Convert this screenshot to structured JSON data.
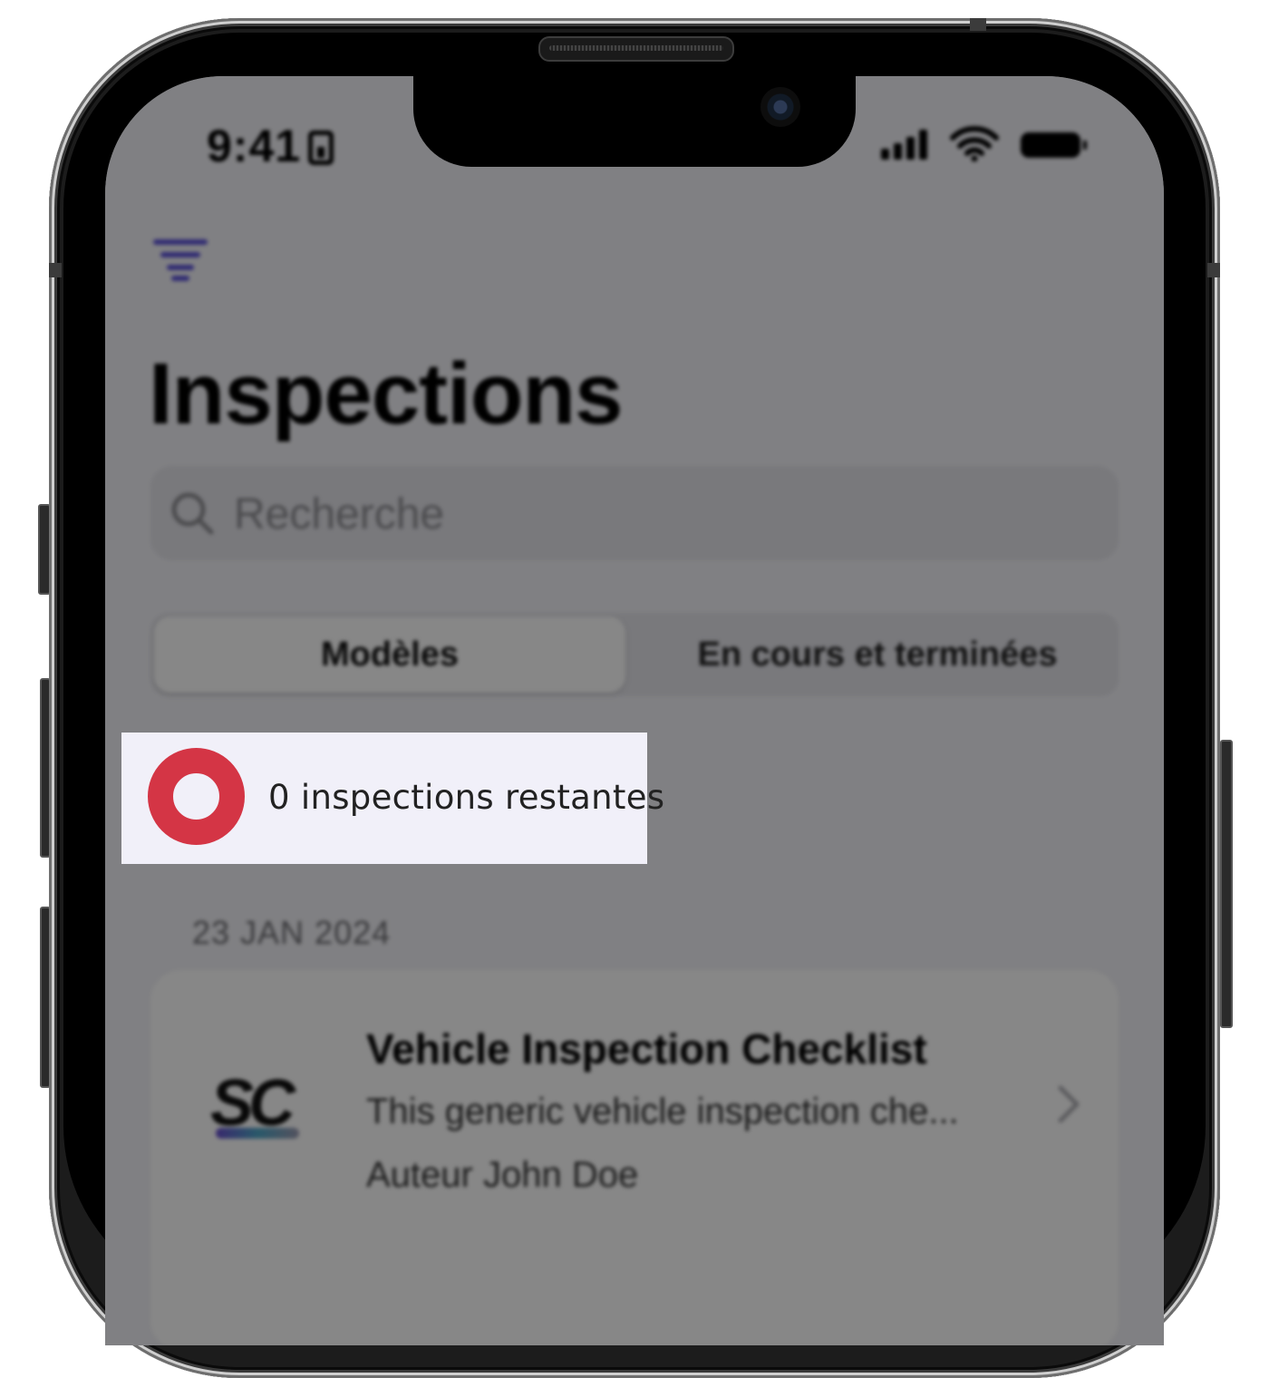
{
  "status_bar": {
    "time": "9:41"
  },
  "header": {
    "title": "Inspections"
  },
  "search": {
    "placeholder": "Recherche"
  },
  "tabs": [
    {
      "label": "Modèles",
      "active": true
    },
    {
      "label": "En cours et terminées",
      "active": false
    }
  ],
  "toast": {
    "text": "0 inspections restantes",
    "ring_color": "#d43545"
  },
  "list": {
    "section_date": "23 JAN 2024",
    "items": [
      {
        "logo_text": "SC",
        "title": "Vehicle Inspection Checklist",
        "description": "This generic vehicle inspection che...",
        "author": "Auteur John Doe"
      }
    ]
  },
  "colors": {
    "accent": "#5b51d8",
    "screen_bg": "#f2f2f7",
    "overlay": "rgba(0,0,0,0.47)"
  }
}
